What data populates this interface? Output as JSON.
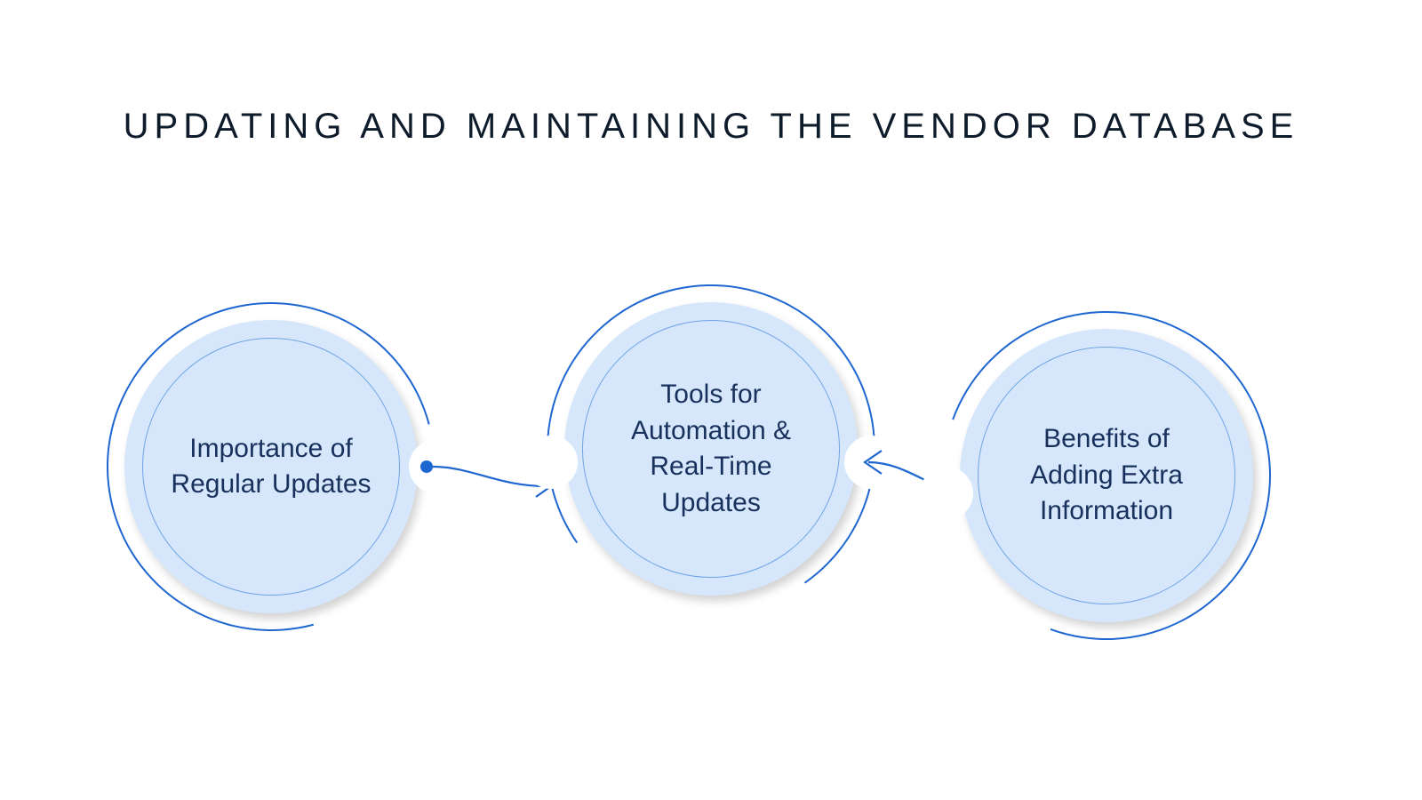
{
  "title": "UPDATING AND MAINTAINING THE VENDOR DATABASE",
  "nodes": {
    "n1": "Importance of Regular Updates",
    "n2": "Tools for Automation & Real-Time Updates",
    "n3": "Benefits of Adding Extra Information"
  },
  "colors": {
    "stroke": "#1e66d0",
    "fill": "#d6e7fb",
    "text": "#18305c"
  }
}
